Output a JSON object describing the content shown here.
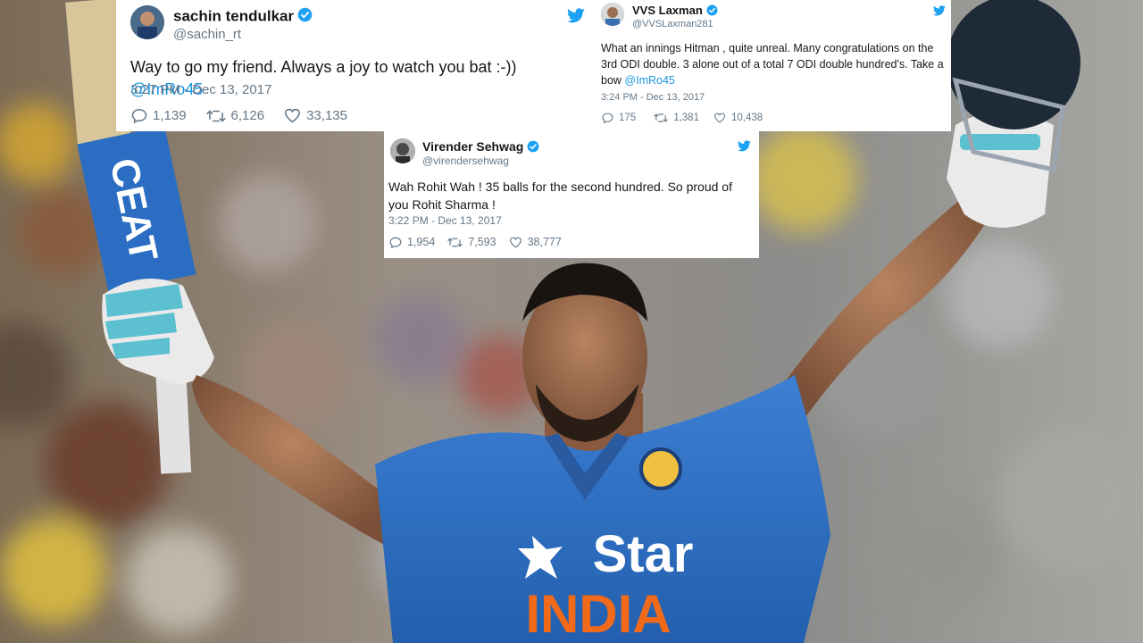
{
  "colors": {
    "twitter_blue": "#1da1f2",
    "link": "#1b95e0",
    "muted": "#657786",
    "jersey": "#2e6fc4",
    "bat_sticker": "#2a6dc2"
  },
  "tweets": {
    "sachin": {
      "name": "sachin tendulkar",
      "handle": "@sachin_rt",
      "text_before": "Way to go my friend. Always a joy to watch you bat :-)) ",
      "mention": "@ImRo45",
      "time": "3:27 PM - Dec 13, 2017",
      "replies": "1,139",
      "retweets": "6,126",
      "likes": "33,135"
    },
    "laxman": {
      "name": "VVS Laxman",
      "handle": "@VVSLaxman281",
      "text_before": "What an innings Hitman , quite unreal. Many congratulations on the 3rd ODI double. 3 alone out of a total 7 ODI double hundred's. Take a bow ",
      "mention": "@ImRo45",
      "time": "3:24 PM - Dec 13, 2017",
      "replies": "175",
      "retweets": "1,381",
      "likes": "10,438"
    },
    "sehwag": {
      "name": "Virender Sehwag",
      "handle": "@virendersehwag",
      "text": "Wah Rohit Wah ! 35 balls for the second hundred. So proud of you Rohit Sharma !",
      "time": "3:22 PM - Dec 13, 2017",
      "replies": "1,954",
      "retweets": "7,593",
      "likes": "38,777"
    }
  },
  "photo": {
    "bat_brand": "CEAT",
    "jersey_sponsor": "Star",
    "jersey_team": "INDIA"
  }
}
